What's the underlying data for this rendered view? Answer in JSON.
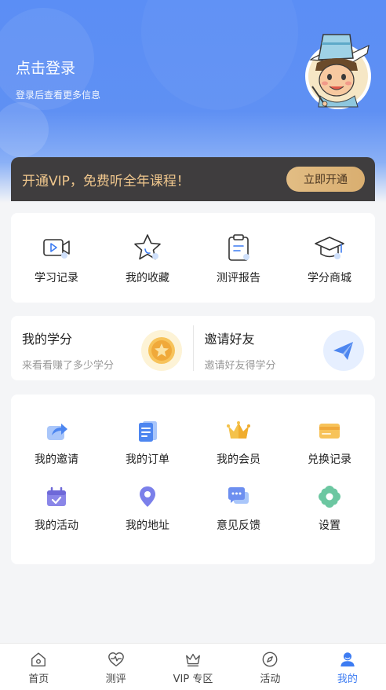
{
  "header": {
    "login_title": "点击登录",
    "login_sub": "登录后查看更多信息"
  },
  "vip": {
    "text": "开通VIP，免费听全年课程！",
    "button": "立即开通"
  },
  "quick_links": [
    {
      "label": "学习记录",
      "icon": "video-record-icon"
    },
    {
      "label": "我的收藏",
      "icon": "star-icon"
    },
    {
      "label": "测评报告",
      "icon": "clipboard-icon"
    },
    {
      "label": "学分商城",
      "icon": "graduation-cap-icon"
    }
  ],
  "credits": {
    "title": "我的学分",
    "sub": "来看看赚了多少学分"
  },
  "invite": {
    "title": "邀请好友",
    "sub": "邀请好友得学分"
  },
  "services": [
    {
      "label": "我的邀请",
      "icon": "share-icon"
    },
    {
      "label": "我的订单",
      "icon": "order-icon"
    },
    {
      "label": "我的会员",
      "icon": "crown-icon"
    },
    {
      "label": "兑换记录",
      "icon": "card-icon"
    },
    {
      "label": "我的活动",
      "icon": "calendar-icon"
    },
    {
      "label": "我的地址",
      "icon": "location-icon"
    },
    {
      "label": "意见反馈",
      "icon": "feedback-icon"
    },
    {
      "label": "设置",
      "icon": "settings-icon"
    }
  ],
  "tabs": [
    {
      "label": "首页",
      "icon": "home-icon"
    },
    {
      "label": "测评",
      "icon": "heart-pulse-icon"
    },
    {
      "label": "VIP 专区",
      "icon": "crown-outline-icon"
    },
    {
      "label": "活动",
      "icon": "compass-icon"
    },
    {
      "label": "我的",
      "icon": "user-icon",
      "active": true
    }
  ],
  "colors": {
    "primary": "#3d7cf2",
    "vip_gold": "#f0c78d",
    "vip_dark": "#3f3d3e"
  }
}
